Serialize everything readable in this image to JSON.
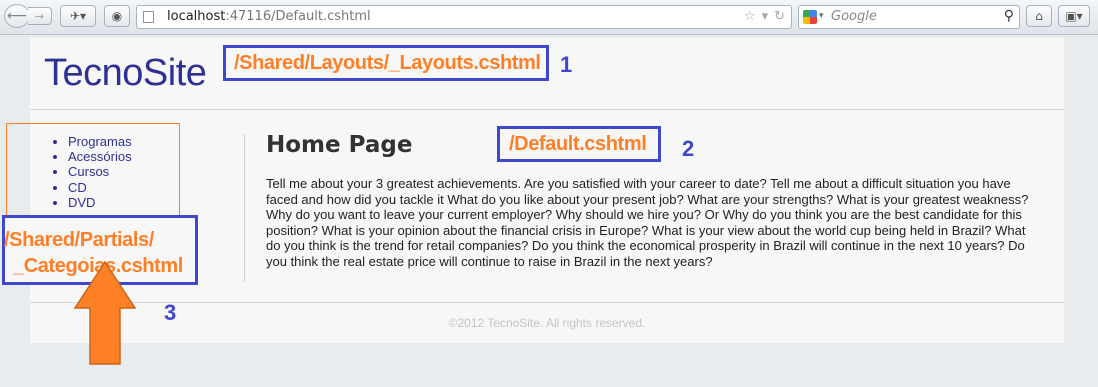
{
  "browser": {
    "url_host": "localhost",
    "url_rest": ":47116/Default.cshtml",
    "search_placeholder": "Google"
  },
  "site": {
    "title": "TecnoSite",
    "nav_items": [
      "Programas",
      "Acessórios",
      "Cursos",
      "CD",
      "DVD"
    ],
    "content_heading": "Home Page",
    "content_body": "Tell me about your 3 greatest achievements. Are you satisfied with your career to date? Tell me about a difficult situation you have faced and how did you tackle it What do you like about your present job? What are your strengths? What is your greatest weakness? Why do you want to leave your current employer? Why should we hire you? Or Why do you think you are the best candidate for this position? What is your opinion about the financial crisis in Europe? What is your view about the world cup being held in Brazil? What do you think is the trend for retail companies? Do you think the economical prosperity in Brazil will continue in the next 10 years? Do you think the real estate price will continue to raise in Brazil in the next years?",
    "footer": "©2012 TecnoSite. All rights reserved."
  },
  "annotations": {
    "layout": {
      "label": "/Shared/Layouts/_Layouts.cshtml",
      "number": "1"
    },
    "default": {
      "label": "/Default.cshtml",
      "number": "2"
    },
    "partial": {
      "label_line1": "/Shared/Partials/",
      "label_line2": "_Categoias.cshtml",
      "number": "3"
    }
  },
  "colors": {
    "annotation_box": "#3f48cc",
    "annotation_text": "#ff7f27",
    "site_title": "#2e3092",
    "arrow": "#ff7f27"
  }
}
